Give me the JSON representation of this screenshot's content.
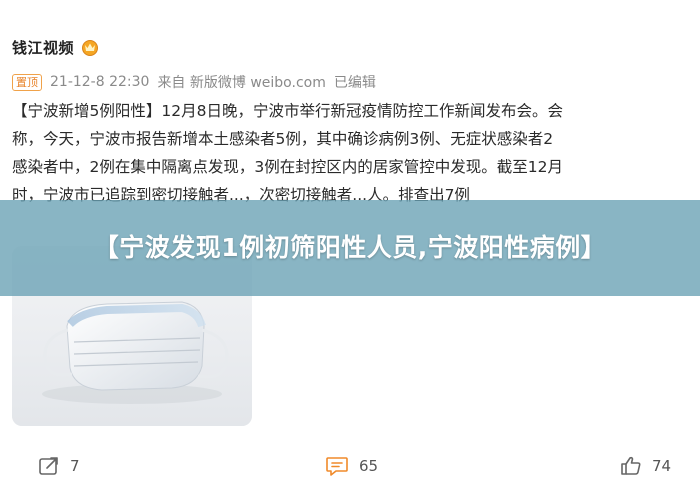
{
  "post": {
    "author": {
      "name": "钱江视频",
      "badge_icon": "gold-crown-badge-icon"
    },
    "meta": {
      "top_badge": "置顶",
      "datetime": "21-12-8 22:30",
      "source": "来自 新版微博 weibo.com",
      "edited": "已编辑"
    },
    "body_lines": [
      "【宁波新增5例阳性】12月8日晚，宁波市举行新冠疫情防控工作新闻发布会。会",
      "称，今天，宁波市报告新增本土感染者5例，其中确诊病例3例、无症状感染者2",
      "感染者中，2例在集中隔离点发现，3例在封控区内的居家管控中发现。截至12月",
      "时，宁波市已追踪到密切接触者...，次密切接触者...人。排查出7例"
    ],
    "image": {
      "subject": "face-mask-photo"
    },
    "overlay_title": "【宁波发现1例初筛阳性人员,宁波阳性病例】",
    "actions": {
      "forward_count": "7",
      "comment_count": "65",
      "like_count": "74"
    }
  },
  "colors": {
    "overlay_bg": "#68a0b4",
    "badge_orange": "#e8842b",
    "meta_gray": "#8a8a8a",
    "comment_icon_orange": "#f08a2a"
  }
}
